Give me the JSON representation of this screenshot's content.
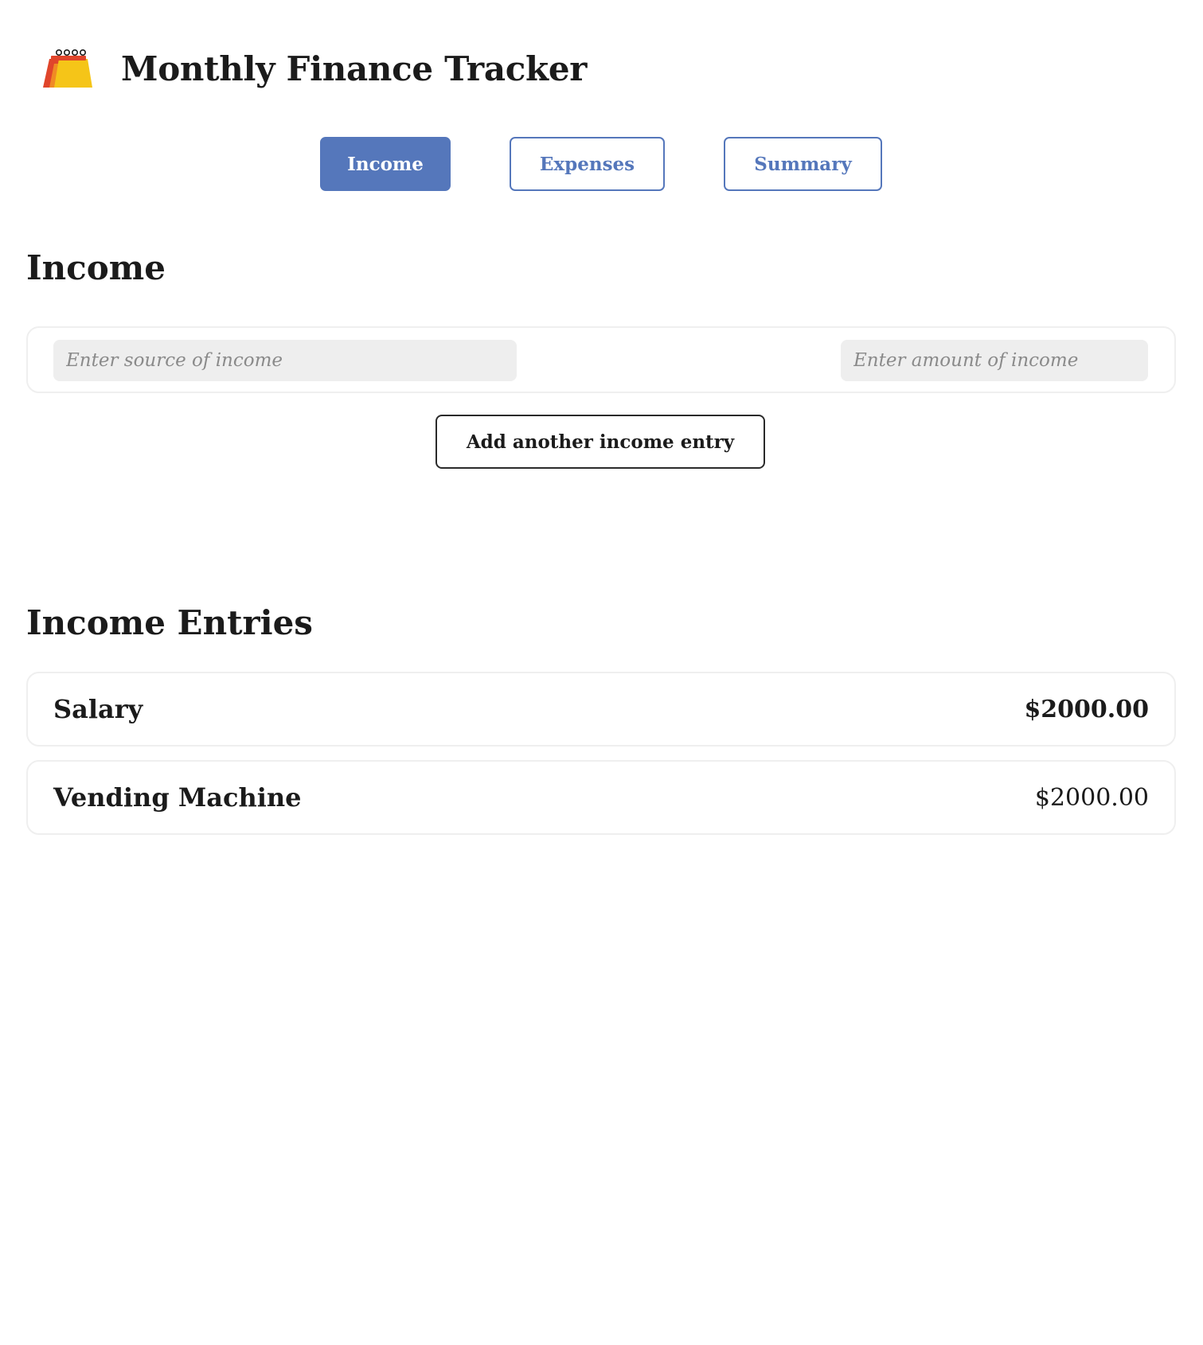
{
  "header": {
    "title": "Monthly Finance Tracker",
    "logo_icon": "calendar-icon"
  },
  "tabs": [
    {
      "label": "Income",
      "active": true
    },
    {
      "label": "Expenses",
      "active": false
    },
    {
      "label": "Summary",
      "active": false
    }
  ],
  "income_form": {
    "title": "Income",
    "source_placeholder": "Enter source of income",
    "source_value": "",
    "amount_placeholder": "Enter amount of income",
    "amount_value": "",
    "add_button_label": "Add another income entry"
  },
  "entries": {
    "title": "Income Entries",
    "items": [
      {
        "name": "Salary",
        "amount": "$2000.00"
      },
      {
        "name": "Vending Machine",
        "amount": "$2000.00"
      }
    ]
  },
  "colors": {
    "accent": "#5577bb",
    "logo_yellow": "#f5c518",
    "logo_red": "#e0452b",
    "logo_orange": "#f08a24",
    "text": "#1b1b1b",
    "field_bg": "#eeeeee"
  }
}
